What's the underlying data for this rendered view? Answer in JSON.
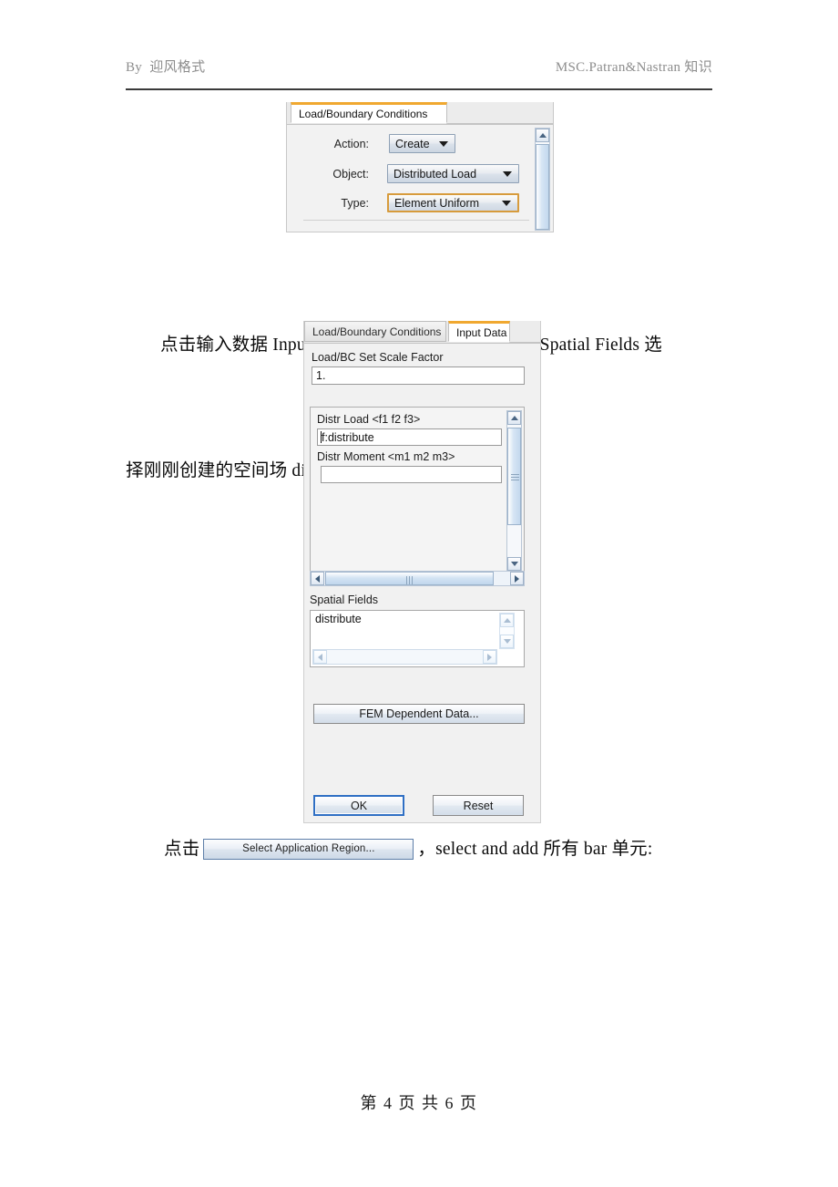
{
  "header": {
    "left": "By  迎风格式",
    "right": "MSC.Patran&Nastran 知识"
  },
  "footer": {
    "text": "第 4 页 共 6 页"
  },
  "paragraphs": {
    "p1_line1": "点击输入数据 Input data，点击 Distr load 栏后在 Spatial Fields 选",
    "p1_line2_a": "择刚刚创建的空间场 distribute，then click ",
    "p1_line2_italic": "OK",
    "p1_line2_b": ":",
    "p2_prefix": "点击",
    "p2_button": "Select Application Region...",
    "p2_suffix": "，select and add 所有 bar 单元:"
  },
  "dialog_lbc": {
    "tabs": [
      {
        "label": "Load/Boundary Conditions",
        "active": true
      }
    ],
    "rows": [
      {
        "label": "Action:",
        "value": "Create"
      },
      {
        "label": "Object:",
        "value": "Distributed Load"
      },
      {
        "label": "Type:",
        "value": "Element Uniform"
      }
    ],
    "accent_color": "#f0a830",
    "focus_border_color": "#d79b3c"
  },
  "dialog_input": {
    "tabs": [
      {
        "label": "Load/Boundary Conditions",
        "active": false
      },
      {
        "label": "Input Data",
        "active": true
      }
    ],
    "scale_factor": {
      "label": "Load/BC Set Scale Factor",
      "value": "1."
    },
    "distr_load": {
      "label": "Distr Load <f1  f2  f3>",
      "value": "f:distribute"
    },
    "distr_moment": {
      "label": "Distr Moment <m1  m2  m3>",
      "value": ""
    },
    "spatial_fields": {
      "label": "Spatial Fields",
      "items": [
        "distribute"
      ]
    },
    "buttons": {
      "fem_dependent": "FEM Dependent Data...",
      "ok": "OK",
      "reset": "Reset"
    },
    "ok_focus_color": "#2f6fc4"
  }
}
